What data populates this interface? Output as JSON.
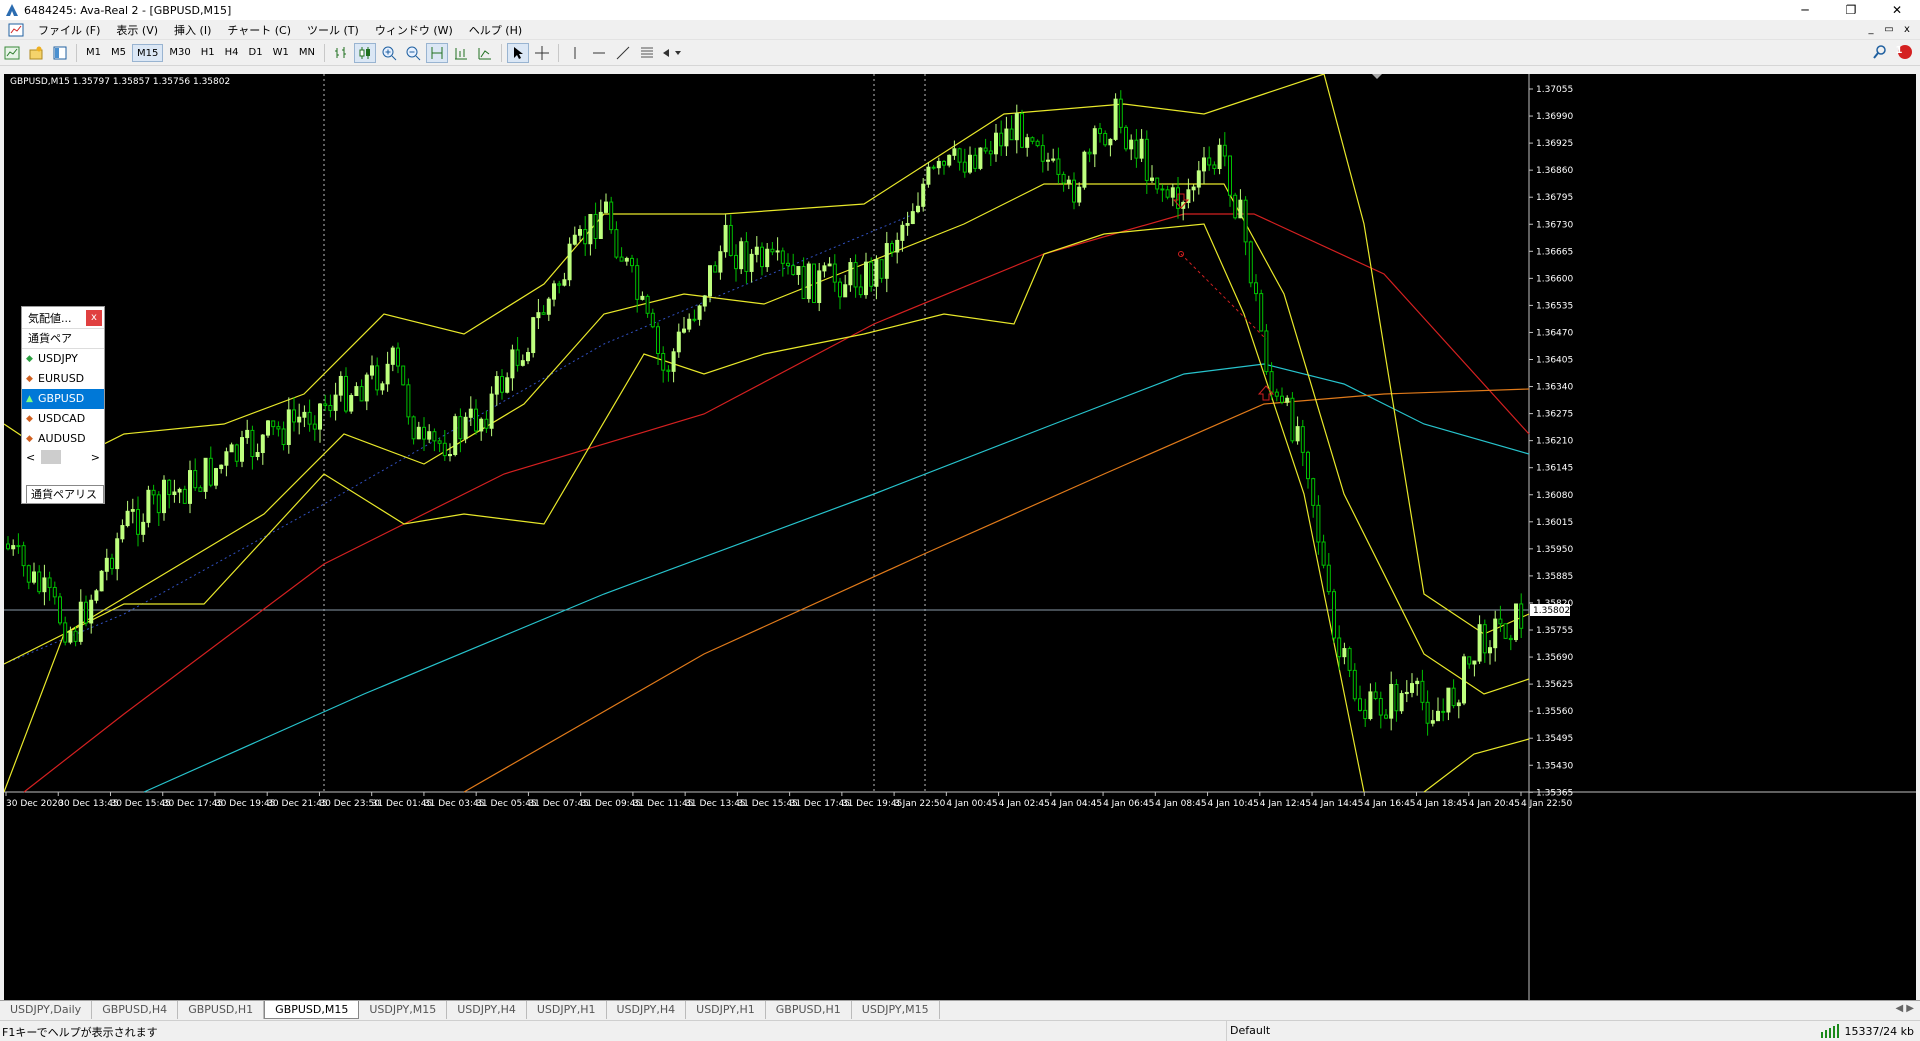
{
  "window": {
    "title": "6484245: Ava-Real 2 - [GBPUSD,M15]",
    "minimize": "─",
    "restore": "❐",
    "close": "✕"
  },
  "menu": {
    "items": [
      "ファイル (F)",
      "表示 (V)",
      "挿入 (I)",
      "チャート (C)",
      "ツール (T)",
      "ウィンドウ (W)",
      "ヘルプ (H)"
    ],
    "mdi": [
      "_",
      "▭",
      "x"
    ]
  },
  "toolbar": {
    "timeframes": [
      "M1",
      "M5",
      "M15",
      "M30",
      "H1",
      "H4",
      "D1",
      "W1",
      "MN"
    ],
    "active_timeframe": "M15",
    "notification_count": "1"
  },
  "chart": {
    "info": "GBPUSD,M15  1.35797 1.35857 1.35756 1.35802",
    "current_price": "1.35802",
    "price_ticks": [
      "1.37055",
      "1.36990",
      "1.36925",
      "1.36860",
      "1.36795",
      "1.36730",
      "1.36665",
      "1.36600",
      "1.36535",
      "1.36470",
      "1.36405",
      "1.36340",
      "1.36275",
      "1.36210",
      "1.36145",
      "1.36080",
      "1.36015",
      "1.35950",
      "1.35885",
      "1.35820",
      "1.35755",
      "1.35690",
      "1.35625",
      "1.35560",
      "1.35495",
      "1.35430",
      "1.35365"
    ],
    "time_ticks": [
      "30 Dec 2020",
      "30 Dec 13:45",
      "30 Dec 15:45",
      "30 Dec 17:45",
      "30 Dec 19:45",
      "30 Dec 21:45",
      "30 Dec 23:50",
      "31 Dec 01:45",
      "31 Dec 03:45",
      "31 Dec 05:45",
      "31 Dec 07:45",
      "31 Dec 09:45",
      "31 Dec 11:45",
      "31 Dec 13:45",
      "31 Dec 15:45",
      "31 Dec 17:45",
      "31 Dec 19:45",
      "3 Jan 22:50",
      "4 Jan 00:45",
      "4 Jan 02:45",
      "4 Jan 04:45",
      "4 Jan 06:45",
      "4 Jan 08:45",
      "4 Jan 10:45",
      "4 Jan 12:45",
      "4 Jan 14:45",
      "4 Jan 16:45",
      "4 Jan 18:45",
      "4 Jan 20:45",
      "4 Jan 22:50"
    ],
    "colors": {
      "background": "#000000",
      "bull": "#bfff7f",
      "bear": "#00c000",
      "bollinger": "#e8e82a",
      "ma_fast": "#d42020",
      "ma_mid": "#27c3cc",
      "ma_slow": "#e07a1a",
      "text": "#ffffff"
    }
  },
  "market_watch": {
    "title": "気配値...",
    "close": "x",
    "header": "通貨ペア",
    "symbols": [
      {
        "name": "USDJPY",
        "selected": false,
        "arrow": "◆",
        "color": "#2aa040"
      },
      {
        "name": "EURUSD",
        "selected": false,
        "arrow": "◆",
        "color": "#d06020"
      },
      {
        "name": "GBPUSD",
        "selected": true,
        "arrow": "▲",
        "color": "#7fff7f"
      },
      {
        "name": "USDCAD",
        "selected": false,
        "arrow": "◆",
        "color": "#d06020"
      },
      {
        "name": "AUDUSD",
        "selected": false,
        "arrow": "◆",
        "color": "#d06020"
      }
    ],
    "tab": "通貨ペアリスト"
  },
  "tabs": {
    "items": [
      "USDJPY,Daily",
      "GBPUSD,H4",
      "GBPUSD,H1",
      "GBPUSD,M15",
      "USDJPY,M15",
      "USDJPY,H4",
      "USDJPY,H1",
      "USDJPY,H4",
      "USDJPY,H1",
      "GBPUSD,H1",
      "USDJPY,M15"
    ],
    "active": "GBPUSD,M15",
    "nav": "◀ ▶"
  },
  "status": {
    "help": "F1キーでヘルプが表示されます",
    "profile": "Default",
    "traffic": "15337/24 kb"
  }
}
